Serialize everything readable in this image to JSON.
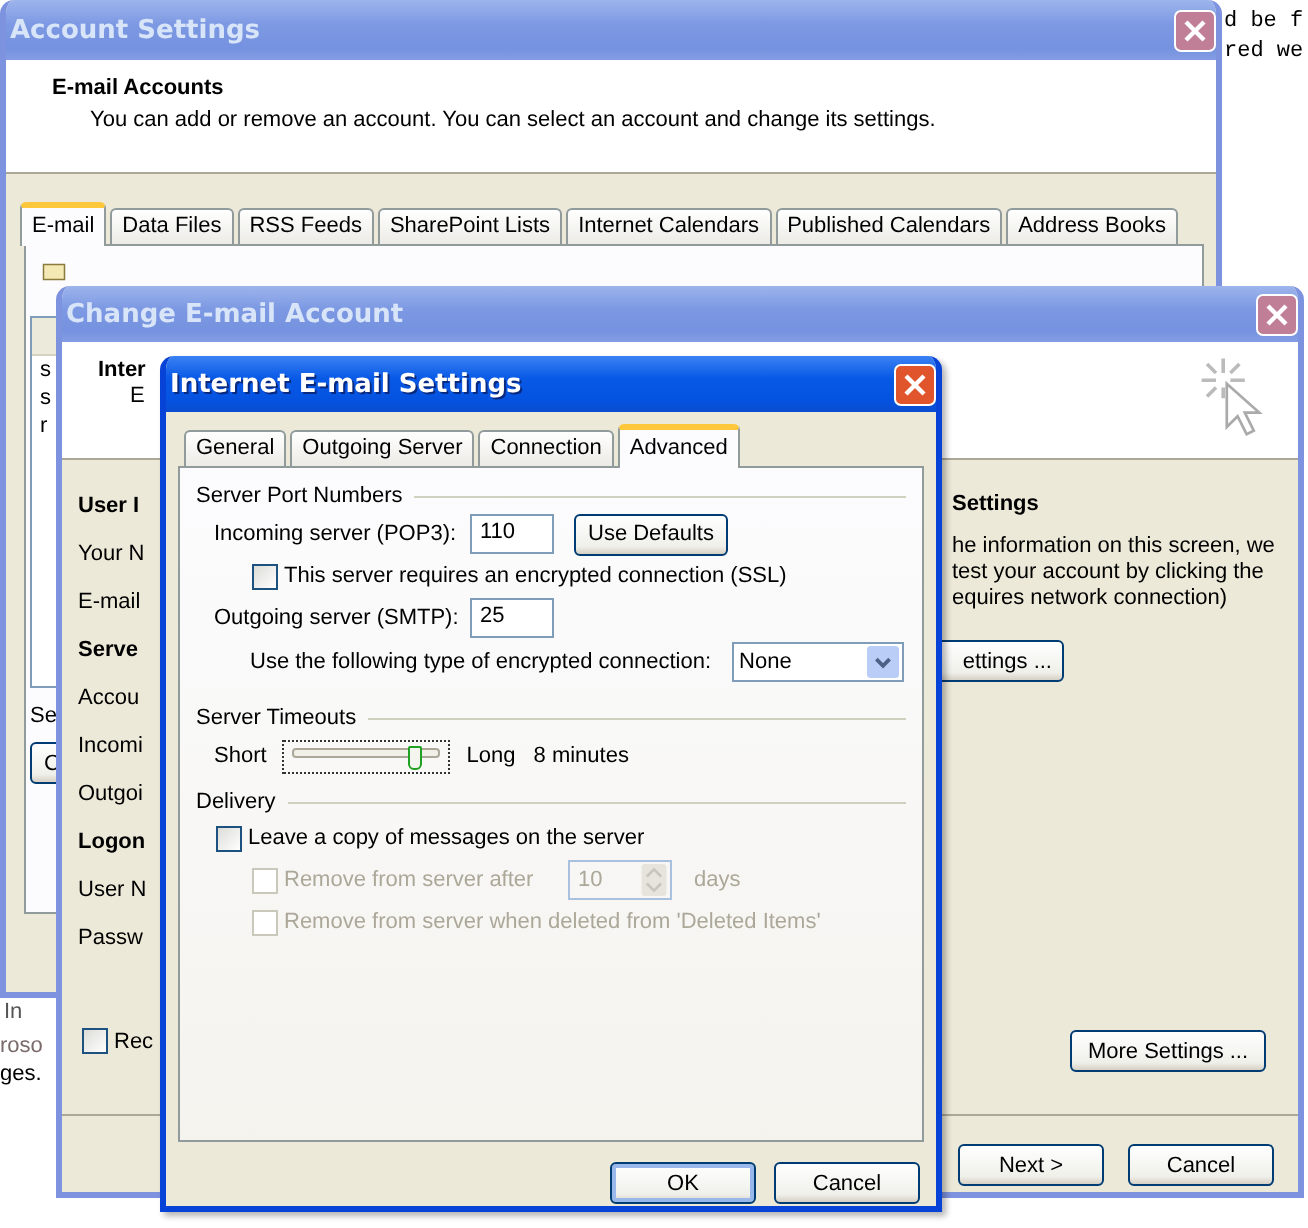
{
  "desktop": {
    "text_lines": [
      "d be f",
      "red we"
    ],
    "list_header": "In",
    "list_lines": [
      "roso",
      "ges."
    ]
  },
  "account_settings": {
    "title": "Account Settings",
    "active": false,
    "heading": "E-mail Accounts",
    "description": "You can add or remove an account. You can select an account and change its settings.",
    "tabs": [
      {
        "label": "E-mail",
        "selected": true
      },
      {
        "label": "Data Files",
        "selected": false
      },
      {
        "label": "RSS Feeds",
        "selected": false
      },
      {
        "label": "SharePoint Lists",
        "selected": false
      },
      {
        "label": "Internet Calendars",
        "selected": false
      },
      {
        "label": "Published Calendars",
        "selected": false
      },
      {
        "label": "Address Books",
        "selected": false
      }
    ],
    "account_list": [
      "s",
      "s",
      "r"
    ],
    "selected_label": "Se",
    "change_button": "C"
  },
  "change_account": {
    "title": "Change E-mail Account",
    "active": false,
    "header_title": "Inter",
    "header_subtitle": "E",
    "left_labels": [
      {
        "text": "User I",
        "kind": "heading"
      },
      {
        "text": "Your N",
        "kind": "label"
      },
      {
        "text": "E-mail",
        "kind": "label"
      },
      {
        "text": "Serve",
        "kind": "heading"
      },
      {
        "text": "Accou",
        "kind": "label"
      },
      {
        "text": "Incomi",
        "kind": "label"
      },
      {
        "text": "Outgoi",
        "kind": "label"
      },
      {
        "text": "Logon",
        "kind": "heading"
      },
      {
        "text": "User N",
        "kind": "label"
      },
      {
        "text": "Passw",
        "kind": "label"
      }
    ],
    "remember": {
      "label": "Rec",
      "checked": false
    },
    "test_heading": "Settings",
    "test_lines": [
      "he information on this screen, we",
      "test your account by clicking the",
      "equires network connection)"
    ],
    "test_button": "ettings ...",
    "more_settings": "More Settings ...",
    "buttons": [
      "Next >",
      "Cancel"
    ]
  },
  "email_settings": {
    "title": "Internet E-mail Settings",
    "active": true,
    "tabs": [
      {
        "label": "General",
        "selected": false
      },
      {
        "label": "Outgoing Server",
        "selected": false
      },
      {
        "label": "Connection",
        "selected": false
      },
      {
        "label": "Advanced",
        "selected": true
      }
    ],
    "port_section": "Server Port Numbers",
    "incoming_label": "Incoming server (POP3):",
    "incoming_port": "110",
    "use_defaults": "Use Defaults",
    "ssl": {
      "label": "This server requires an encrypted connection (SSL)",
      "checked": false
    },
    "outgoing_label": "Outgoing server (SMTP):",
    "outgoing_port": "25",
    "encryption_label": "Use the following type of encrypted connection:",
    "encryption": "None",
    "timeout_section": "Server Timeouts",
    "timeout": {
      "min_label": "Short",
      "max_label": "Long",
      "level": 0.8,
      "reading": "8 minutes"
    },
    "delivery_section": "Delivery",
    "leave_copy": {
      "label": "Leave a copy of messages on the server",
      "checked": false
    },
    "remove_after": {
      "label": "Remove from server after",
      "checked": false,
      "disabled": true,
      "value": "10",
      "unit": "days"
    },
    "remove_deleted": {
      "label": "Remove from server when deleted from 'Deleted Items'",
      "checked": false,
      "disabled": true
    },
    "buttons": [
      {
        "label": "OK",
        "default": true
      },
      {
        "label": "Cancel",
        "default": false
      }
    ]
  }
}
